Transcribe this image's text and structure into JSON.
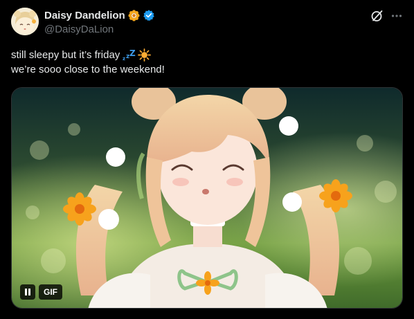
{
  "author": {
    "display_name": "Daisy Dandelion",
    "handle": "@DaisyDaLion",
    "badge_icon": "flower-icon",
    "verified_icon": "verified-badge-icon"
  },
  "actions": {
    "grok_icon": "grok-icon",
    "more_icon": "more-icon"
  },
  "post": {
    "line1": "still sleepy but it’s friday",
    "line1_emoji": [
      "zzz-emoji",
      "sun-emoji"
    ],
    "line2": "we’re sooo close to the weekend!"
  },
  "media": {
    "type": "gif",
    "gif_label": "GIF",
    "pause_icon": "pause-icon"
  },
  "colors": {
    "background": "#000000",
    "text": "#e7e9ea",
    "secondary_text": "#71767b",
    "verified": "#1d9bf0",
    "border": "#2f3336"
  }
}
